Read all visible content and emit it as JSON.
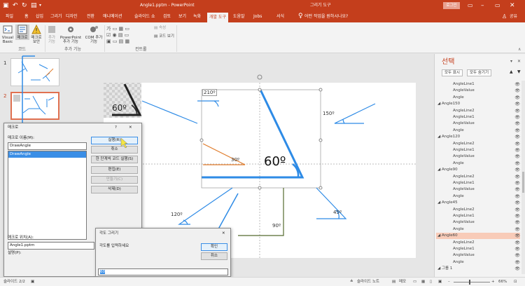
{
  "window": {
    "title": "Angle1.pptm - PowerPoint",
    "context_tab": "그리기 도구",
    "login_label": "로그인",
    "share_label": "공유"
  },
  "tabs": [
    "파일",
    "홈",
    "삽입",
    "그리기",
    "디자인",
    "전환",
    "애니메이션",
    "슬라이드 쇼",
    "검토",
    "보기",
    "녹화",
    "개발 도구",
    "도움말",
    "Jobs",
    "서식"
  ],
  "tell_me": "어떤 작업을 원하시나요?",
  "ribbon": {
    "code": {
      "label": "코드",
      "visual_basic": "Visual Basic",
      "macros": "매크로",
      "macro_security": "매크로 보안"
    },
    "addins": {
      "label": "추가 기능",
      "addins": "추가 기능",
      "ppt_addins": "PowerPoint 추가 기능",
      "com_addins": "COM 추가 기능"
    },
    "controls": {
      "label": "컨트롤",
      "properties": "속성",
      "view_code": "코드 보기"
    }
  },
  "slides": [
    {
      "number": "1"
    },
    {
      "number": "2"
    }
  ],
  "slide": {
    "angles": [
      {
        "label": "210º"
      },
      {
        "label": "150º"
      },
      {
        "label": "30º"
      },
      {
        "label": "60º"
      },
      {
        "label": "120º"
      },
      {
        "label": "45º"
      },
      {
        "label": "90º"
      },
      {
        "label": "60º"
      }
    ]
  },
  "selection_pane": {
    "title": "선택",
    "show_all": "모두 표시",
    "hide_all": "모두 숨기기",
    "items": [
      {
        "label": "AngleLine1",
        "indent": 2,
        "selected": false
      },
      {
        "label": "AngleValue",
        "indent": 2,
        "selected": false
      },
      {
        "label": "Angle",
        "indent": 2,
        "selected": false
      },
      {
        "label": "Angle150",
        "indent": 1,
        "selected": false
      },
      {
        "label": "AngleLine2",
        "indent": 2,
        "selected": false
      },
      {
        "label": "AngleLine1",
        "indent": 2,
        "selected": false
      },
      {
        "label": "AngleValue",
        "indent": 2,
        "selected": false
      },
      {
        "label": "Angle",
        "indent": 2,
        "selected": false
      },
      {
        "label": "Angle120",
        "indent": 1,
        "selected": false
      },
      {
        "label": "AngleLine2",
        "indent": 2,
        "selected": false
      },
      {
        "label": "AngleLine1",
        "indent": 2,
        "selected": false
      },
      {
        "label": "AngleValue",
        "indent": 2,
        "selected": false
      },
      {
        "label": "Angle",
        "indent": 2,
        "selected": false
      },
      {
        "label": "Angle90",
        "indent": 1,
        "selected": false
      },
      {
        "label": "AngleLine2",
        "indent": 2,
        "selected": false
      },
      {
        "label": "AngleLine1",
        "indent": 2,
        "selected": false
      },
      {
        "label": "AngleValue",
        "indent": 2,
        "selected": false
      },
      {
        "label": "Angle",
        "indent": 2,
        "selected": false
      },
      {
        "label": "Angle45",
        "indent": 1,
        "selected": false
      },
      {
        "label": "AngleLine2",
        "indent": 2,
        "selected": false
      },
      {
        "label": "AngleLine1",
        "indent": 2,
        "selected": false
      },
      {
        "label": "AngleValue",
        "indent": 2,
        "selected": false
      },
      {
        "label": "Angle",
        "indent": 2,
        "selected": false
      },
      {
        "label": "Angle60",
        "indent": 1,
        "selected": true
      },
      {
        "label": "AngleLine2",
        "indent": 2,
        "selected": false
      },
      {
        "label": "AngleLine1",
        "indent": 2,
        "selected": false
      },
      {
        "label": "AngleValue",
        "indent": 2,
        "selected": false
      },
      {
        "label": "Angle",
        "indent": 2,
        "selected": false
      },
      {
        "label": "그룹 1",
        "indent": 1,
        "selected": false
      }
    ]
  },
  "macro_dialog": {
    "title": "매크로",
    "help": "?",
    "close": "✕",
    "name_label": "매크로 이름(M):",
    "name_value": "DrawAngle",
    "list": [
      "DrawAngle"
    ],
    "buttons": [
      "실행(R)",
      "취소",
      "한 단계씩 코드 실행(S)",
      "편집(E)",
      "만들기(C)",
      "삭제(D)"
    ],
    "location_label": "매크로 위치(A):",
    "location_value": "Angle1.pptm",
    "description_label": "설명(P):"
  },
  "angle_dialog": {
    "title": "각도 그리기",
    "close": "✕",
    "prompt": "각도를 입력하세요",
    "ok": "확인",
    "cancel": "취소",
    "value": "60"
  },
  "status": {
    "slide_info": "슬라이드 2/2",
    "notes": "슬라이드 노트",
    "comments": "메모",
    "zoom": "66%"
  },
  "colors": {
    "accent": "#c43e1c",
    "angle_line": "#2e8be6",
    "selection_highlight": "#f8cbb8"
  }
}
